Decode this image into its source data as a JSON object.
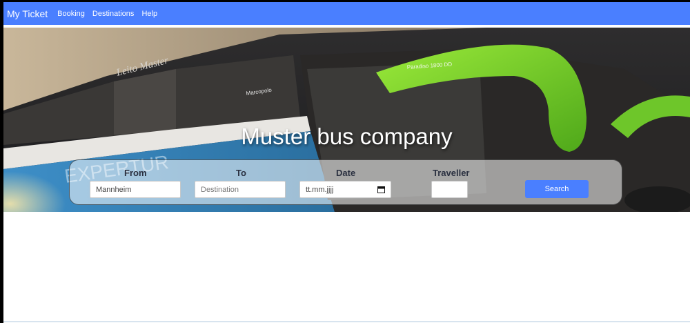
{
  "navbar": {
    "brand": "My Ticket",
    "links": [
      "Booking",
      "Destinations",
      "Help"
    ]
  },
  "hero": {
    "title": "Muster bus company",
    "bus_text": {
      "side_script": "Leito Master",
      "badge": "Marcopolo",
      "green_trim": "Paradiso 1800 DD",
      "side_brand": "EXPERTUR"
    }
  },
  "search": {
    "from": {
      "label": "From",
      "value": "Mannheim"
    },
    "to": {
      "label": "To",
      "placeholder": "Destination"
    },
    "date": {
      "label": "Date",
      "placeholder": "tt.mm.jjjj"
    },
    "traveller": {
      "label": "Traveller",
      "value": ""
    },
    "button_label": "Search"
  },
  "colors": {
    "primary": "#4a7fff",
    "bus_green": "#7ed321"
  }
}
